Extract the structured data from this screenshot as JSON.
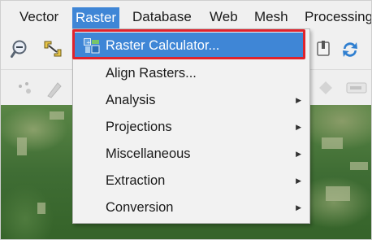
{
  "menubar": {
    "items": [
      {
        "label": "Vector"
      },
      {
        "label": "Raster",
        "active": true
      },
      {
        "label": "Database"
      },
      {
        "label": "Web"
      },
      {
        "label": "Mesh"
      },
      {
        "label": "Processing"
      }
    ]
  },
  "raster_menu": {
    "items": [
      {
        "label": "Raster Calculator...",
        "submenu": false,
        "highlighted": true,
        "icon": "raster-calculator-icon"
      },
      {
        "label": "Align Rasters...",
        "submenu": false
      },
      {
        "label": "Analysis",
        "submenu": true
      },
      {
        "label": "Projections",
        "submenu": true
      },
      {
        "label": "Miscellaneous",
        "submenu": true
      },
      {
        "label": "Extraction",
        "submenu": true
      },
      {
        "label": "Conversion",
        "submenu": true
      }
    ],
    "submenu_arrow": "▶"
  },
  "toolbar": {
    "icons": [
      "zoom-out-icon",
      "pan-map-icon",
      "pin-icon",
      "refresh-icon"
    ]
  },
  "colors": {
    "highlight": "#3f86d6",
    "annotation_border": "#e0232c",
    "menu_bg": "#f2f2f2"
  }
}
